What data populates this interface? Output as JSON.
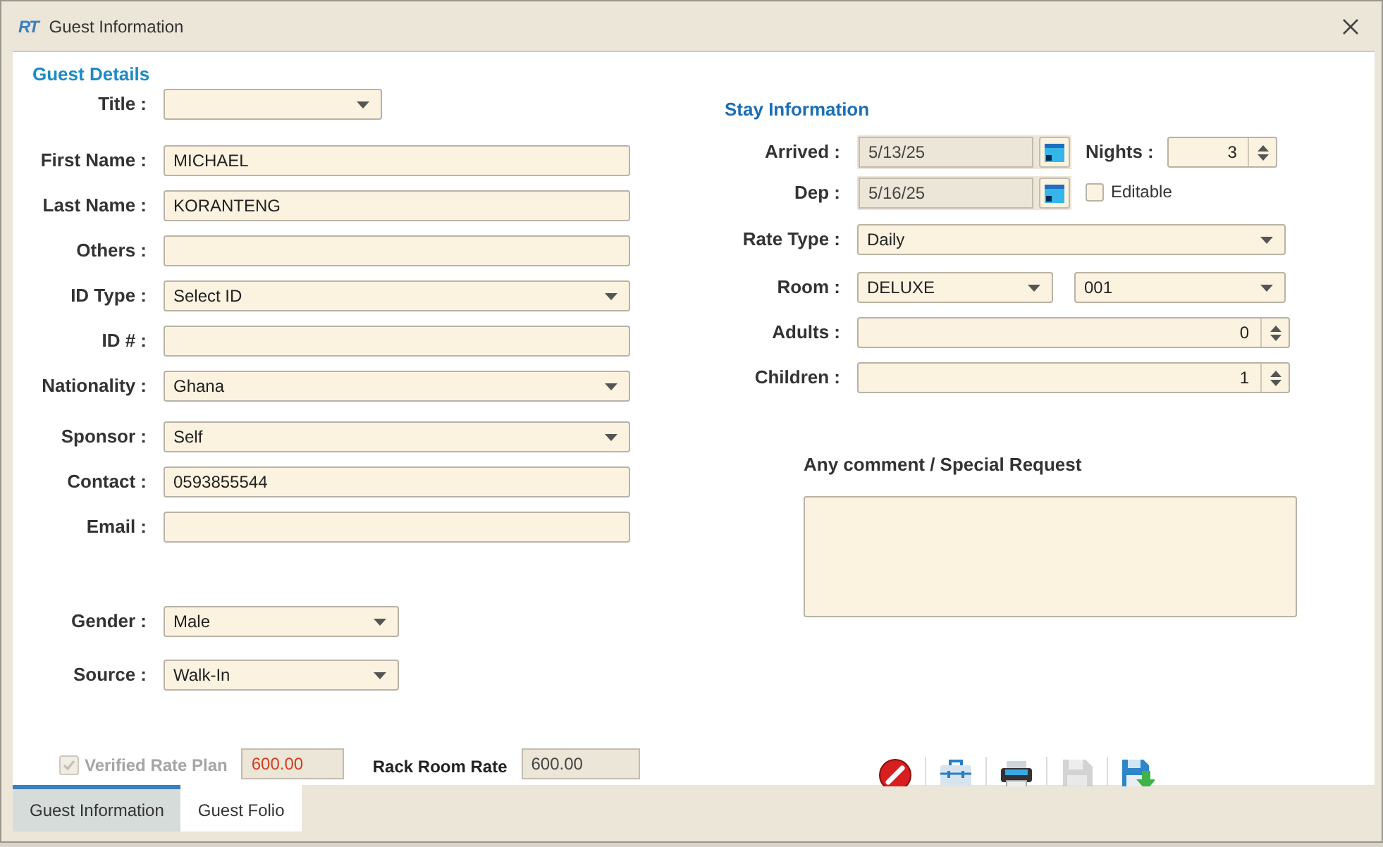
{
  "window": {
    "title": "Guest Information",
    "logo": "RT"
  },
  "guest_details": {
    "heading": "Guest Details",
    "fields": [
      {
        "label": "Title :",
        "kind": "select"
      },
      {
        "label": "First Name :",
        "kind": "text",
        "value": "MICHAEL"
      },
      {
        "label": "Last Name :",
        "kind": "text",
        "value": "KORANTENG"
      },
      {
        "label": "Others :",
        "kind": "text"
      },
      {
        "label": "ID Type :",
        "kind": "select",
        "value": "Select ID"
      },
      {
        "label": "ID # :",
        "kind": "text"
      },
      {
        "label": "Nationality :",
        "kind": "select",
        "value": "Ghana"
      },
      {
        "label": "Sponsor :",
        "kind": "select",
        "value": "Self"
      },
      {
        "label": "Contact :",
        "kind": "text",
        "value": "0593855544"
      },
      {
        "label": "Email :",
        "kind": "text"
      },
      {
        "label": "Gender :",
        "kind": "select",
        "value": "Male"
      },
      {
        "label": "Source :",
        "kind": "select",
        "value": "Walk-In"
      }
    ]
  },
  "stay_information": {
    "heading": "Stay Information",
    "arrived": {
      "label": "Arrived :",
      "value": "5/13/25"
    },
    "departure": {
      "label": "Dep :",
      "value": "5/16/25"
    },
    "nights": {
      "label": "Nights :",
      "value": "3"
    },
    "editable": {
      "label": "Editable",
      "checked": false
    },
    "fields": [
      {
        "label": "Rate Type :",
        "kind": "select",
        "values": [
          "Daily"
        ]
      },
      {
        "label": "Room :",
        "kind": "select",
        "values": [
          "DELUXE",
          "001"
        ]
      },
      {
        "label": "Adults :",
        "kind": "spinner",
        "values": [
          "0"
        ]
      },
      {
        "label": "Children :",
        "kind": "spinner",
        "values": [
          "1"
        ]
      }
    ],
    "comment": {
      "label": "Any comment / Special Request"
    }
  },
  "rates": {
    "verified_rate_plan": {
      "label": "Verified Rate Plan",
      "checked": true,
      "disabled": true,
      "value": "600.00"
    },
    "rack_room_rate": {
      "label": "Rack Room Rate",
      "value": "600.00"
    }
  },
  "toolbar": [
    {
      "kind": "cancel",
      "disabled": false
    },
    {
      "kind": "toolbox",
      "disabled": false
    },
    {
      "kind": "print",
      "disabled": false
    },
    {
      "kind": "save",
      "disabled": true
    },
    {
      "kind": "save-download",
      "disabled": false
    }
  ],
  "tabs": [
    {
      "label": "Guest Information",
      "selected": true
    },
    {
      "label": "Guest Folio",
      "selected": false
    }
  ]
}
